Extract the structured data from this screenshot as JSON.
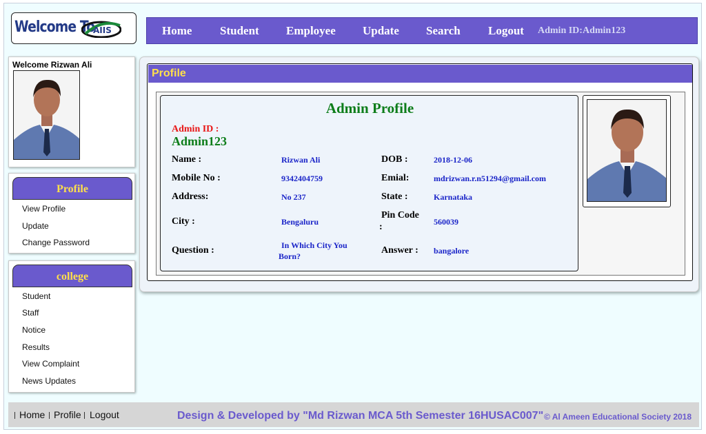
{
  "header": {
    "logo_text": "Welcome To",
    "logo_brand": "AIIS",
    "nav": [
      {
        "label": "Home"
      },
      {
        "label": "Student"
      },
      {
        "label": "Employee"
      },
      {
        "label": "Update"
      },
      {
        "label": "Search"
      },
      {
        "label": "Logout"
      }
    ],
    "admin_id_text": "Admin ID:Admin123"
  },
  "sidebar": {
    "welcome": "Welcome Rizwan Ali",
    "profile_menu": {
      "title": "Profile",
      "items": [
        "View Profile",
        "Update",
        "Change Password"
      ]
    },
    "college_menu": {
      "title": "college",
      "items": [
        "Student",
        "Staff",
        "Notice",
        "Results",
        "View Complaint",
        "News Updates"
      ]
    }
  },
  "main": {
    "section_title": "Profile",
    "card_title": "Admin Profile",
    "admin_id_label": "Admin ID :",
    "admin_id_value": "Admin123",
    "fields": {
      "name_label": "Name :",
      "name_value": "Rizwan Ali",
      "dob_label": "DOB :",
      "dob_value": "2018-12-06",
      "mobile_label": "Mobile No :",
      "mobile_value": "9342404759",
      "email_label": "Emial:",
      "email_value": "mdrizwan.r.n51294@gmail.com",
      "address_label": "Address:",
      "address_value": "No 237",
      "state_label": "State :",
      "state_value": "Karnataka",
      "city_label": "City :",
      "city_value": "Bengaluru",
      "pin_label": "Pin Code",
      "pin_colon": ":",
      "pin_value": "560039",
      "question_label": "Question :",
      "question_value_1": "In Which City You",
      "question_value_2": "Born?",
      "answer_label": "Answer :",
      "answer_value": "bangalore"
    }
  },
  "footer": {
    "links": [
      "Home",
      "Profile",
      "Logout"
    ],
    "developer": "Design & Developed by \"Md Rizwan MCA 5th Semester 16HUSAC007\"",
    "copyright": "© Al Ameen Educational Society 2018"
  },
  "colors": {
    "accent": "#6a5acd",
    "menu_title": "#ffe04a",
    "heading_green": "#0d7d1a",
    "value_blue": "#1a24c8",
    "label_red": "#e81515",
    "page_background": "#effdff"
  }
}
